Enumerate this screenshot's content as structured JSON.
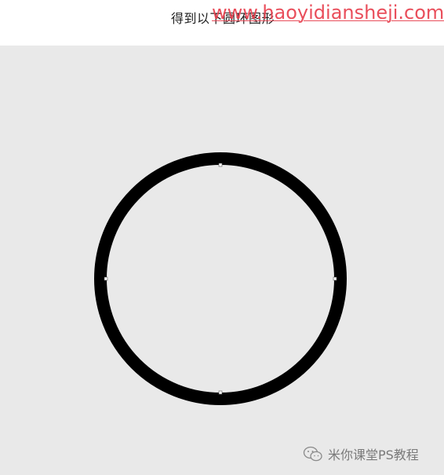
{
  "caption": {
    "text": "得到以下圆环图形"
  },
  "watermark": {
    "url": "www.haoyidiansheji.com",
    "footer_text": "米你课堂PS教程"
  },
  "icons": {
    "footer": "wechat-icon"
  },
  "colors": {
    "canvas_background": "#e9e9e9",
    "ring_stroke": "#000000",
    "watermark_red": "#e8404e"
  }
}
